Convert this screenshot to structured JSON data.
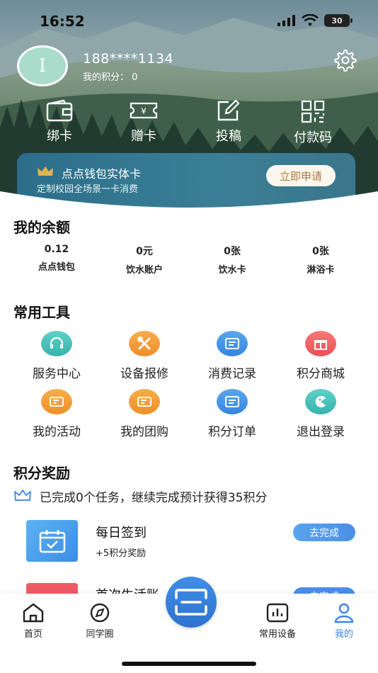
{
  "status_bar": {
    "time": "16:52",
    "battery": "30"
  },
  "profile": {
    "avatar_letter": "I",
    "phone": "188****1134",
    "points_label": "我的积分：",
    "points_value": "0"
  },
  "quick_actions": [
    {
      "label": "绑卡",
      "icon": "wallet-icon"
    },
    {
      "label": "赠卡",
      "icon": "gift-card-icon"
    },
    {
      "label": "投稿",
      "icon": "edit-icon"
    },
    {
      "label": "付款码",
      "icon": "grid-code-icon"
    }
  ],
  "card_banner": {
    "title": "点点钱包实体卡",
    "subtitle": "定制校园全场景一卡消费",
    "button": "立即申请"
  },
  "balance": {
    "title": "我的余额",
    "items": [
      {
        "value": "0.12",
        "name": "点点钱包"
      },
      {
        "value": "0元",
        "name": "饮水账户"
      },
      {
        "value": "0张",
        "name": "饮水卡"
      },
      {
        "value": "0张",
        "name": "淋浴卡"
      }
    ]
  },
  "tools": {
    "title": "常用工具",
    "items": [
      {
        "label": "服务中心",
        "icon": "headset-icon",
        "color": "#46c1b9"
      },
      {
        "label": "设备报修",
        "icon": "wrench-icon",
        "color": "#f29a34"
      },
      {
        "label": "消费记录",
        "icon": "receipt-icon",
        "color": "#4592e7"
      },
      {
        "label": "积分商城",
        "icon": "gift-icon",
        "color": "#f0616a"
      },
      {
        "label": "我的活动",
        "icon": "ticket-icon",
        "color": "#f29a34"
      },
      {
        "label": "我的团购",
        "icon": "coupon-icon",
        "color": "#f29a34"
      },
      {
        "label": "积分订单",
        "icon": "list-icon",
        "color": "#4592e7"
      },
      {
        "label": "退出登录",
        "icon": "logout-icon",
        "color": "#46c1b9"
      }
    ]
  },
  "rewards": {
    "title": "积分奖励",
    "summary": "已完成0个任务，继续完成预计获得35积分",
    "tasks": [
      {
        "name": "每日签到",
        "reward": "+5积分奖励",
        "button": "去完成"
      },
      {
        "name": "首次生活账",
        "button": "去完成"
      }
    ]
  },
  "tabbar": {
    "items": [
      {
        "label": "首页",
        "icon": "home-icon",
        "active": false
      },
      {
        "label": "同学圈",
        "icon": "compass-icon",
        "active": false
      },
      {
        "label": "常用设备",
        "icon": "devices-icon",
        "active": false
      },
      {
        "label": "我的",
        "icon": "person-icon",
        "active": true
      }
    ]
  },
  "colors": {
    "accent": "#3d85e4",
    "gold": "#b07a3c"
  }
}
